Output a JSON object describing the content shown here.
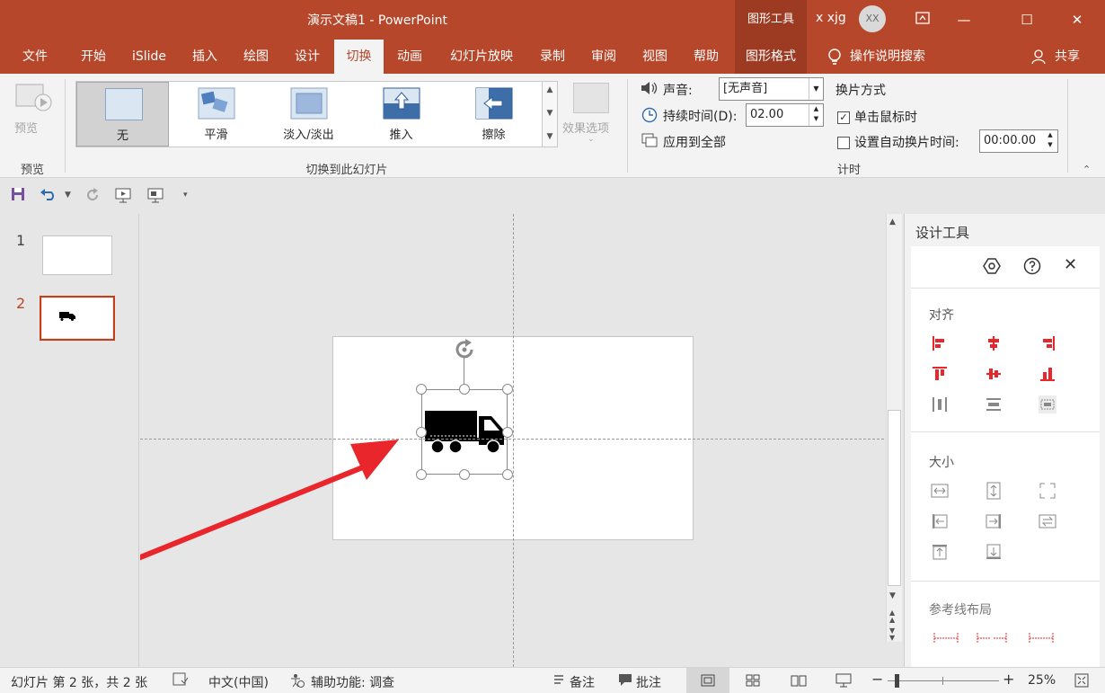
{
  "window": {
    "title": "演示文稿1 - PowerPoint",
    "context_tools": "图形工具",
    "user": "x xjg",
    "avatar_initials": "XX"
  },
  "tabs": [
    "文件",
    "开始",
    "iSlide",
    "插入",
    "绘图",
    "设计",
    "切换",
    "动画",
    "幻灯片放映",
    "录制",
    "审阅",
    "视图",
    "帮助",
    "图形格式"
  ],
  "tell_me": "操作说明搜索",
  "share": "共享",
  "ribbon": {
    "preview_label": "预览",
    "preview_group": "预览",
    "gallery_items": [
      "无",
      "平滑",
      "淡入/淡出",
      "推入",
      "擦除"
    ],
    "effect_options": "效果选项",
    "transition_group": "切换到此幻灯片",
    "sound_label": "声音:",
    "sound_value": "[无声音]",
    "duration_label": "持续时间(D):",
    "duration_value": "02.00",
    "apply_all": "应用到全部",
    "advance_heading": "换片方式",
    "on_click": "单击鼠标时",
    "on_click_checked": true,
    "auto_after": "设置自动换片时间:",
    "auto_after_checked": false,
    "auto_after_value": "00:00.00",
    "timing_group": "计时"
  },
  "slides": [
    {
      "number": "1"
    },
    {
      "number": "2"
    }
  ],
  "pane": {
    "title": "设计工具",
    "align_heading": "对齐",
    "size_heading": "大小",
    "guides_heading": "参考线布局"
  },
  "status": {
    "slide_info": "幻灯片 第 2 张，共 2 张",
    "language": "中文(中国)",
    "accessibility": "辅助功能: 调查",
    "notes": "备注",
    "comments": "批注",
    "zoom": "25%"
  },
  "colors": {
    "accent": "#b7472a",
    "align_icon": "#e8262b",
    "arrow": "#e8262b"
  }
}
